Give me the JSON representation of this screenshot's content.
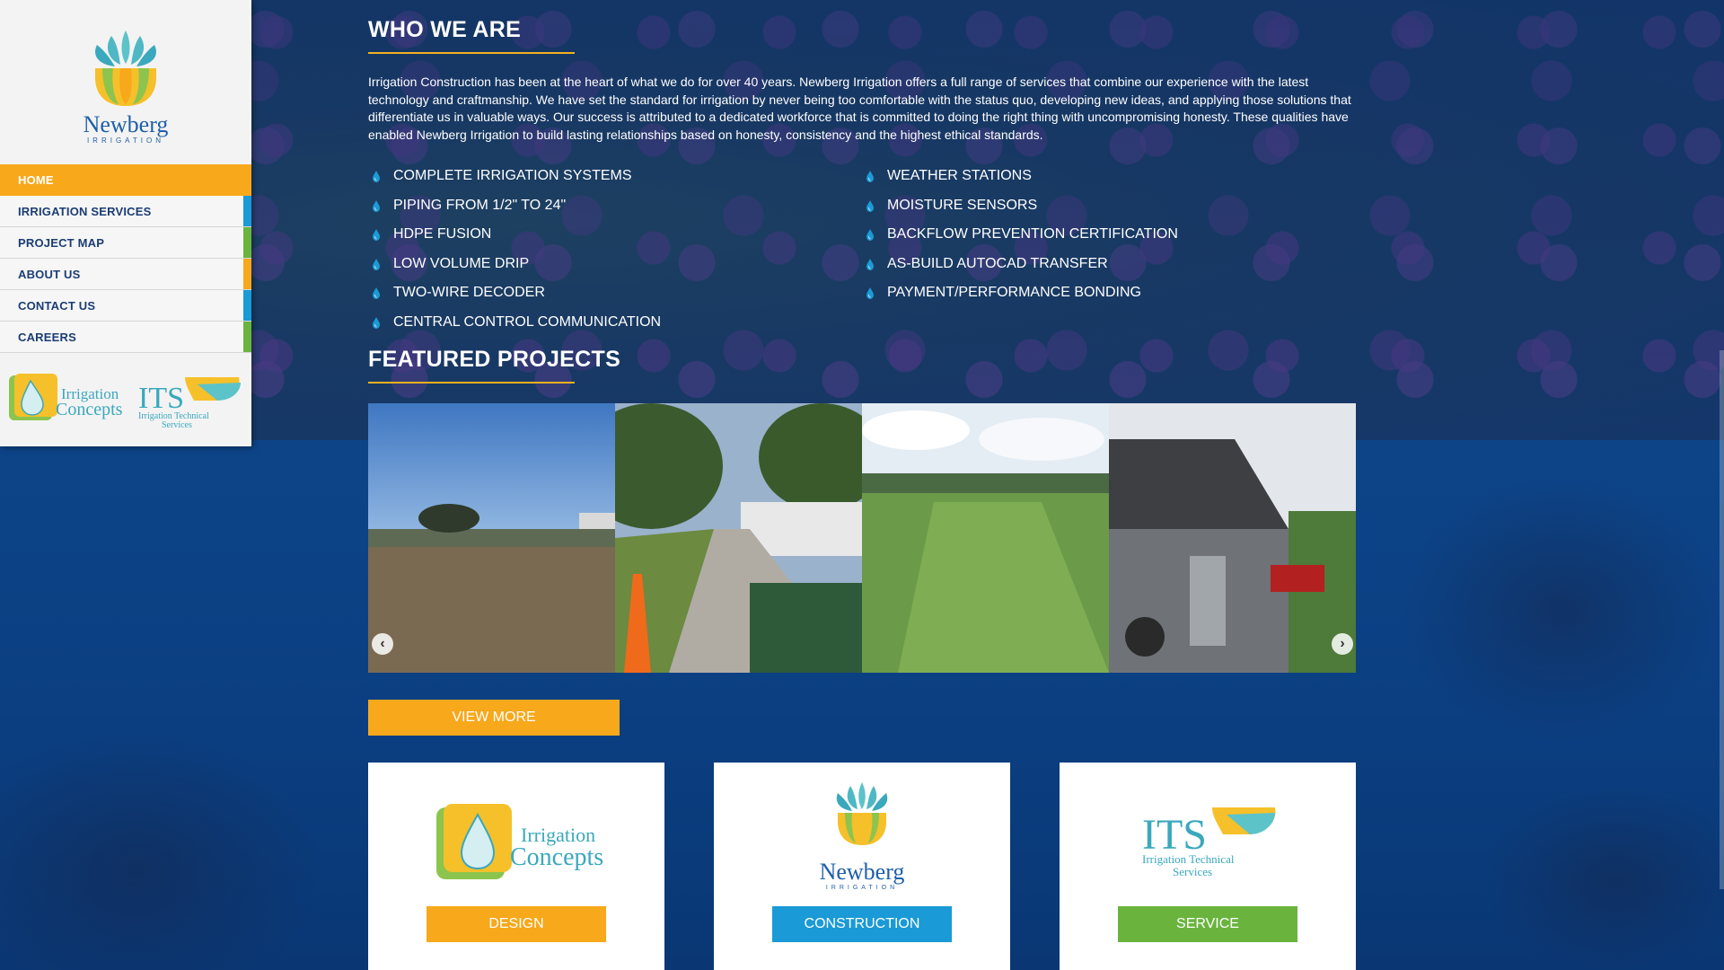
{
  "brand": {
    "name": "Newberg",
    "sub": "IRRIGATION"
  },
  "nav": {
    "items": [
      {
        "label": "HOME",
        "color": "#f7a81b",
        "active": true
      },
      {
        "label": "IRRIGATION SERVICES",
        "color": "#1a9ad6"
      },
      {
        "label": "PROJECT MAP",
        "color": "#6ab43e"
      },
      {
        "label": "ABOUT US",
        "color": "#f7a81b"
      },
      {
        "label": "CONTACT US",
        "color": "#1a9ad6"
      },
      {
        "label": "CAREERS",
        "color": "#6ab43e"
      }
    ]
  },
  "partners": {
    "irrigation_concepts": "Irrigation Concepts",
    "its": "ITS",
    "its_sub1": "Irrigation Technical",
    "its_sub2": "Services"
  },
  "who_we_are": {
    "title": "WHO WE ARE",
    "body": "Irrigation Construction has been at the heart of what we do for over 40 years. Newberg Irrigation offers a full range of services that combine our experience with the latest technology and craftmanship. We have set the standard for irrigation by never being too comfortable with the status quo, developing new ideas, and applying those solutions that differentiate us in valuable ways. Our success is attributed to a dedicated workforce that is committed to doing the right thing with uncompromising honesty. These qualities have enabled Newberg Irrigation to build lasting relationships based on honesty, consistency and the highest ethical standards.",
    "features_left": [
      "COMPLETE IRRIGATION SYSTEMS",
      "PIPING FROM 1/2\" TO 24\"",
      "HDPE FUSION",
      "LOW VOLUME DRIP",
      "TWO-WIRE DECODER",
      "CENTRAL CONTROL COMMUNICATION"
    ],
    "features_right": [
      "WEATHER STATIONS",
      "MOISTURE SENSORS",
      "BACKFLOW PREVENTION CERTIFICATION",
      "AS-BUILD AUTOCAD TRANSFER",
      "PAYMENT/PERFORMANCE BONDING"
    ]
  },
  "featured": {
    "title": "FEATURED PROJECTS",
    "view_more": "VIEW MORE"
  },
  "cards": [
    {
      "button": "DESIGN",
      "color": "#f7a81b"
    },
    {
      "button": "CONSTRUCTION",
      "color": "#1a9ad6"
    },
    {
      "button": "SERVICE",
      "color": "#6ab43e"
    }
  ],
  "colors": {
    "accent": "#f7a81b",
    "blue": "#1a9ad6",
    "green": "#6ab43e",
    "navy": "#1b3d73"
  }
}
